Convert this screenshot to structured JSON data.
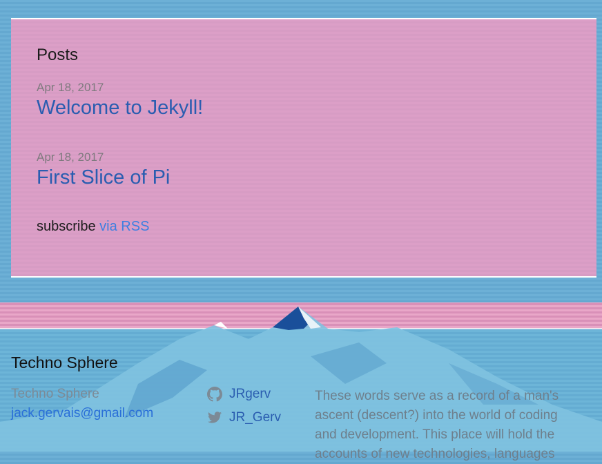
{
  "posts": {
    "heading": "Posts",
    "items": [
      {
        "date": "Apr 18, 2017",
        "title": "Welcome to Jekyll!"
      },
      {
        "date": "Apr 18, 2017",
        "title": "First Slice of Pi"
      }
    ],
    "subscribe_text": "subscribe",
    "rss_link": "via RSS"
  },
  "footer": {
    "title": "Techno Sphere",
    "name": "Techno Sphere",
    "email": "jack.gervais@gmail.com",
    "github": {
      "username": "JRgerv",
      "icon": "github-icon"
    },
    "twitter": {
      "username": "JR_Gerv",
      "icon": "twitter-icon"
    },
    "description": "These words serve as a record of a man's ascent (descent?) into the world of coding and development. This place will hold the accounts of new technologies, languages"
  },
  "colors": {
    "background": "#6db0d6",
    "panel": "#dc9fc7",
    "link": "#2a5db0",
    "accent_link": "#3d7fe0"
  }
}
